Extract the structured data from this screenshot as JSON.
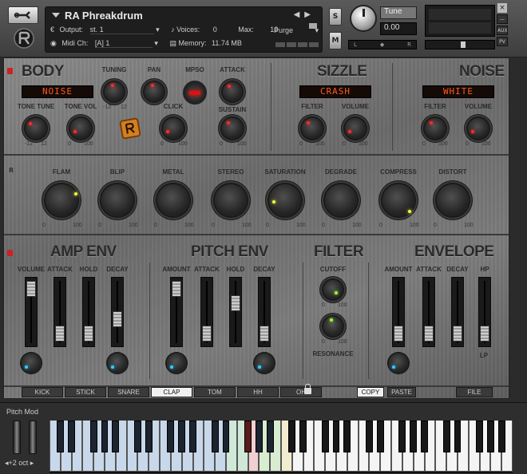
{
  "header": {
    "instrument_name": "RA Phreakdrum",
    "output_label": "Output:",
    "output_value": "st. 1",
    "midi_label": "Midi Ch:",
    "midi_value": "[A]  1",
    "voices_label": "Voices:",
    "voices_value": "0",
    "max_label": "Max:",
    "max_value": "16",
    "memory_label": "Memory:",
    "memory_value": "11.74 MB",
    "purge_label": "Purge",
    "solo_label": "S",
    "mute_label": "M",
    "tune_label": "Tune",
    "tune_value": "0.00",
    "pan_left": "L",
    "pan_right": "R",
    "close_label": "×",
    "aux_label": "AUX",
    "pv_label": "PV"
  },
  "body": {
    "title": "BODY",
    "type_display": "NOISE",
    "labels": {
      "tuning": "TUNING",
      "pan": "PAN",
      "mpso": "MPSO",
      "attack": "ATTACK",
      "tone_tune": "TONE TUNE",
      "tone_vol": "TONE VOL",
      "click": "CLICK",
      "sustain": "SUSTAIN"
    },
    "ticks": {
      "tuning_min": "-12",
      "tuning_max": "12",
      "tt_min": "-12",
      "tt_max": "12",
      "tv_min": "0",
      "tv_max": "100",
      "click_min": "0",
      "click_max": "100",
      "sustain_min": "0",
      "sustain_max": "100"
    }
  },
  "sizzle": {
    "title": "SIZZLE",
    "display": "CRASH",
    "filter_label": "FILTER",
    "volume_label": "VOLUME",
    "ticks": {
      "f_min": "0",
      "f_max": "100",
      "v_min": "0",
      "v_max": "100"
    }
  },
  "noise": {
    "title": "NOISE",
    "display": "WHITE",
    "filter_label": "FILTER",
    "volume_label": "VOLUME",
    "ticks": {
      "f_min": "0",
      "f_max": "100",
      "v_min": "0",
      "v_max": "100"
    }
  },
  "fx": {
    "marker": "R",
    "labels": [
      "FLAM",
      "BLIP",
      "METAL",
      "STEREO",
      "SATURATION",
      "DEGRADE",
      "COMPRESS",
      "DISTORT"
    ],
    "tick_min": "0",
    "tick_max": "100"
  },
  "amp_env": {
    "title": "AMP ENV",
    "labels": [
      "VOLUME",
      "ATTACK",
      "HOLD",
      "DECAY"
    ]
  },
  "pitch_env": {
    "title": "PITCH ENV",
    "labels": [
      "AMOUNT",
      "ATTACK",
      "HOLD",
      "DECAY"
    ]
  },
  "filter": {
    "title": "FILTER",
    "cutoff_label": "CUTOFF",
    "resonance_label": "RESONANCE",
    "ticks": {
      "c_min": "0",
      "c_max": "100",
      "r_min": "0",
      "r_max": "100"
    }
  },
  "envelope": {
    "title": "ENVELOPE",
    "labels": [
      "AMOUNT",
      "ATTACK",
      "DECAY",
      "HP"
    ],
    "lp_label": "LP"
  },
  "tabs": [
    "KICK",
    "STICK",
    "SNARE",
    "CLAP",
    "TOM",
    "HH",
    "OH"
  ],
  "active_tab": "CLAP",
  "copy_label": "COPY",
  "paste_label": "PASTE",
  "file_label": "FILE",
  "keyboard": {
    "pitch_mod_label": "Pitch Mod",
    "octave_label": "◂+2 oct ▸"
  },
  "colors": {
    "led_display": "#ff5a1e",
    "knob_indicator": "#ff2a2a",
    "fx_indicator": "#ef3",
    "env_indicator": "#3cf"
  }
}
